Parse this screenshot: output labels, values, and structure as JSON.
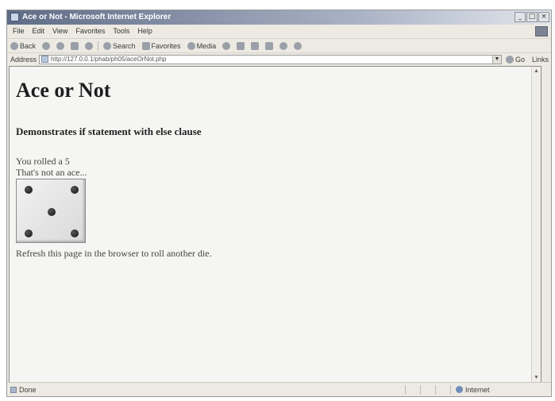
{
  "window": {
    "title": "Ace or Not - Microsoft Internet Explorer",
    "buttons": {
      "minimize": "_",
      "maximize": "□",
      "close": "×"
    }
  },
  "menu": [
    "File",
    "Edit",
    "View",
    "Favorites",
    "Tools",
    "Help"
  ],
  "toolbar": {
    "back": "Back",
    "search": "Search",
    "favorites": "Favorites",
    "media": "Media"
  },
  "address": {
    "label": "Address",
    "url": "http://127.0.0.1/phab/ph05/aceOrNot.php",
    "go": "Go",
    "links": "Links"
  },
  "page": {
    "title": "Ace or Not",
    "subtitle": "Demonstrates if statement with else clause",
    "roll_text": "You rolled a 5",
    "ace_text": "That's not an ace...",
    "die_value": 5,
    "refresh_text": "Refresh this page in the browser to roll another die."
  },
  "status": {
    "text": "Done",
    "zone": "Internet"
  }
}
